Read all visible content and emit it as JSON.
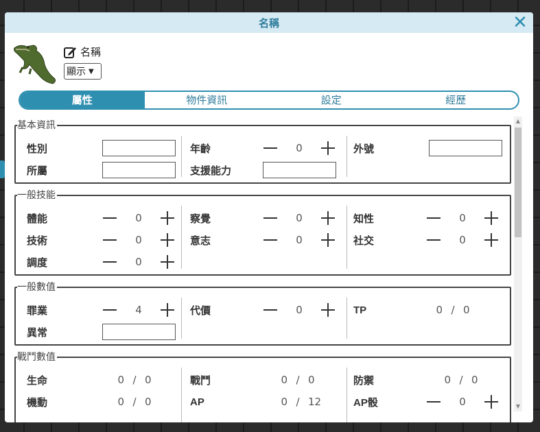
{
  "dialog": {
    "title": "名稱",
    "close_glyph": "✕"
  },
  "header": {
    "avatar": "crocodile-avatar",
    "name_label": "名稱",
    "show_select": {
      "value": "顯示"
    }
  },
  "tabs": [
    {
      "label": "屬性",
      "active": true
    },
    {
      "label": "物件資訊",
      "active": false
    },
    {
      "label": "設定",
      "active": false
    },
    {
      "label": "經歷",
      "active": false
    }
  ],
  "sections": {
    "basic": {
      "title": "基本資訊",
      "gender": "性別",
      "affiliation": "所屬",
      "age": {
        "label": "年齡",
        "value": "0"
      },
      "support": "支援能力",
      "nickname": "外號"
    },
    "skills": {
      "title": "一般技能",
      "physique": {
        "label": "體能",
        "value": "0"
      },
      "perception": {
        "label": "察覺",
        "value": "0"
      },
      "intellect": {
        "label": "知性",
        "value": "0"
      },
      "technique": {
        "label": "技術",
        "value": "0"
      },
      "will": {
        "label": "意志",
        "value": "0"
      },
      "social": {
        "label": "社交",
        "value": "0"
      },
      "composure": {
        "label": "調度",
        "value": "0"
      }
    },
    "values": {
      "title": "一般數值",
      "sin": {
        "label": "罪業",
        "value": "4"
      },
      "price": {
        "label": "代價",
        "value": "0"
      },
      "tp": {
        "label": "TP",
        "cur": "0",
        "sep": "/",
        "max": "0"
      },
      "abnormal": "異常"
    },
    "combat": {
      "title": "戰鬥數值",
      "life": {
        "label": "生命",
        "cur": "0",
        "sep": "/",
        "max": "0"
      },
      "battle": {
        "label": "戰鬥",
        "cur": "0",
        "sep": "/",
        "max": "0"
      },
      "defense": {
        "label": "防禦",
        "cur": "0",
        "sep": "/",
        "max": "0"
      },
      "mobility": {
        "label": "機動",
        "cur": "0",
        "sep": "/",
        "max": "0"
      },
      "ap": {
        "label": "AP",
        "cur": "0",
        "sep": "/",
        "max": "12"
      },
      "ap_die": {
        "label": "AP骰",
        "value": "0"
      }
    }
  },
  "colors": {
    "accent": "#2f8fb0",
    "title_bg": "#d6eaf3"
  }
}
